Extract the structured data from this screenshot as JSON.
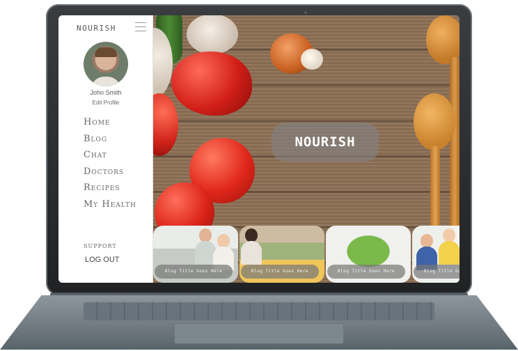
{
  "sidebar": {
    "brand": "NOURISH",
    "user_name": "John Smith",
    "edit_profile": "Edit Profile",
    "nav": [
      "Home",
      "Blog",
      "Chat",
      "Doctors",
      "Recipes",
      "My Health"
    ],
    "support": "SUPPORT",
    "logout": "LOG OUT"
  },
  "hero": {
    "title": "NOURISH"
  },
  "blog": {
    "cards": [
      {
        "label": "Blog Title Goes Here"
      },
      {
        "label": "Blog Title Goes Here"
      },
      {
        "label": "Blog Title Goes Here"
      },
      {
        "label": "Blog Title Goes Here"
      }
    ]
  },
  "colors": {
    "sidebar_bg": "#ffffff",
    "nav_text": "#666666",
    "overlay": "#828282",
    "wood": "#8d7156"
  },
  "icons": [
    "menu-icon",
    "avatar-image"
  ]
}
